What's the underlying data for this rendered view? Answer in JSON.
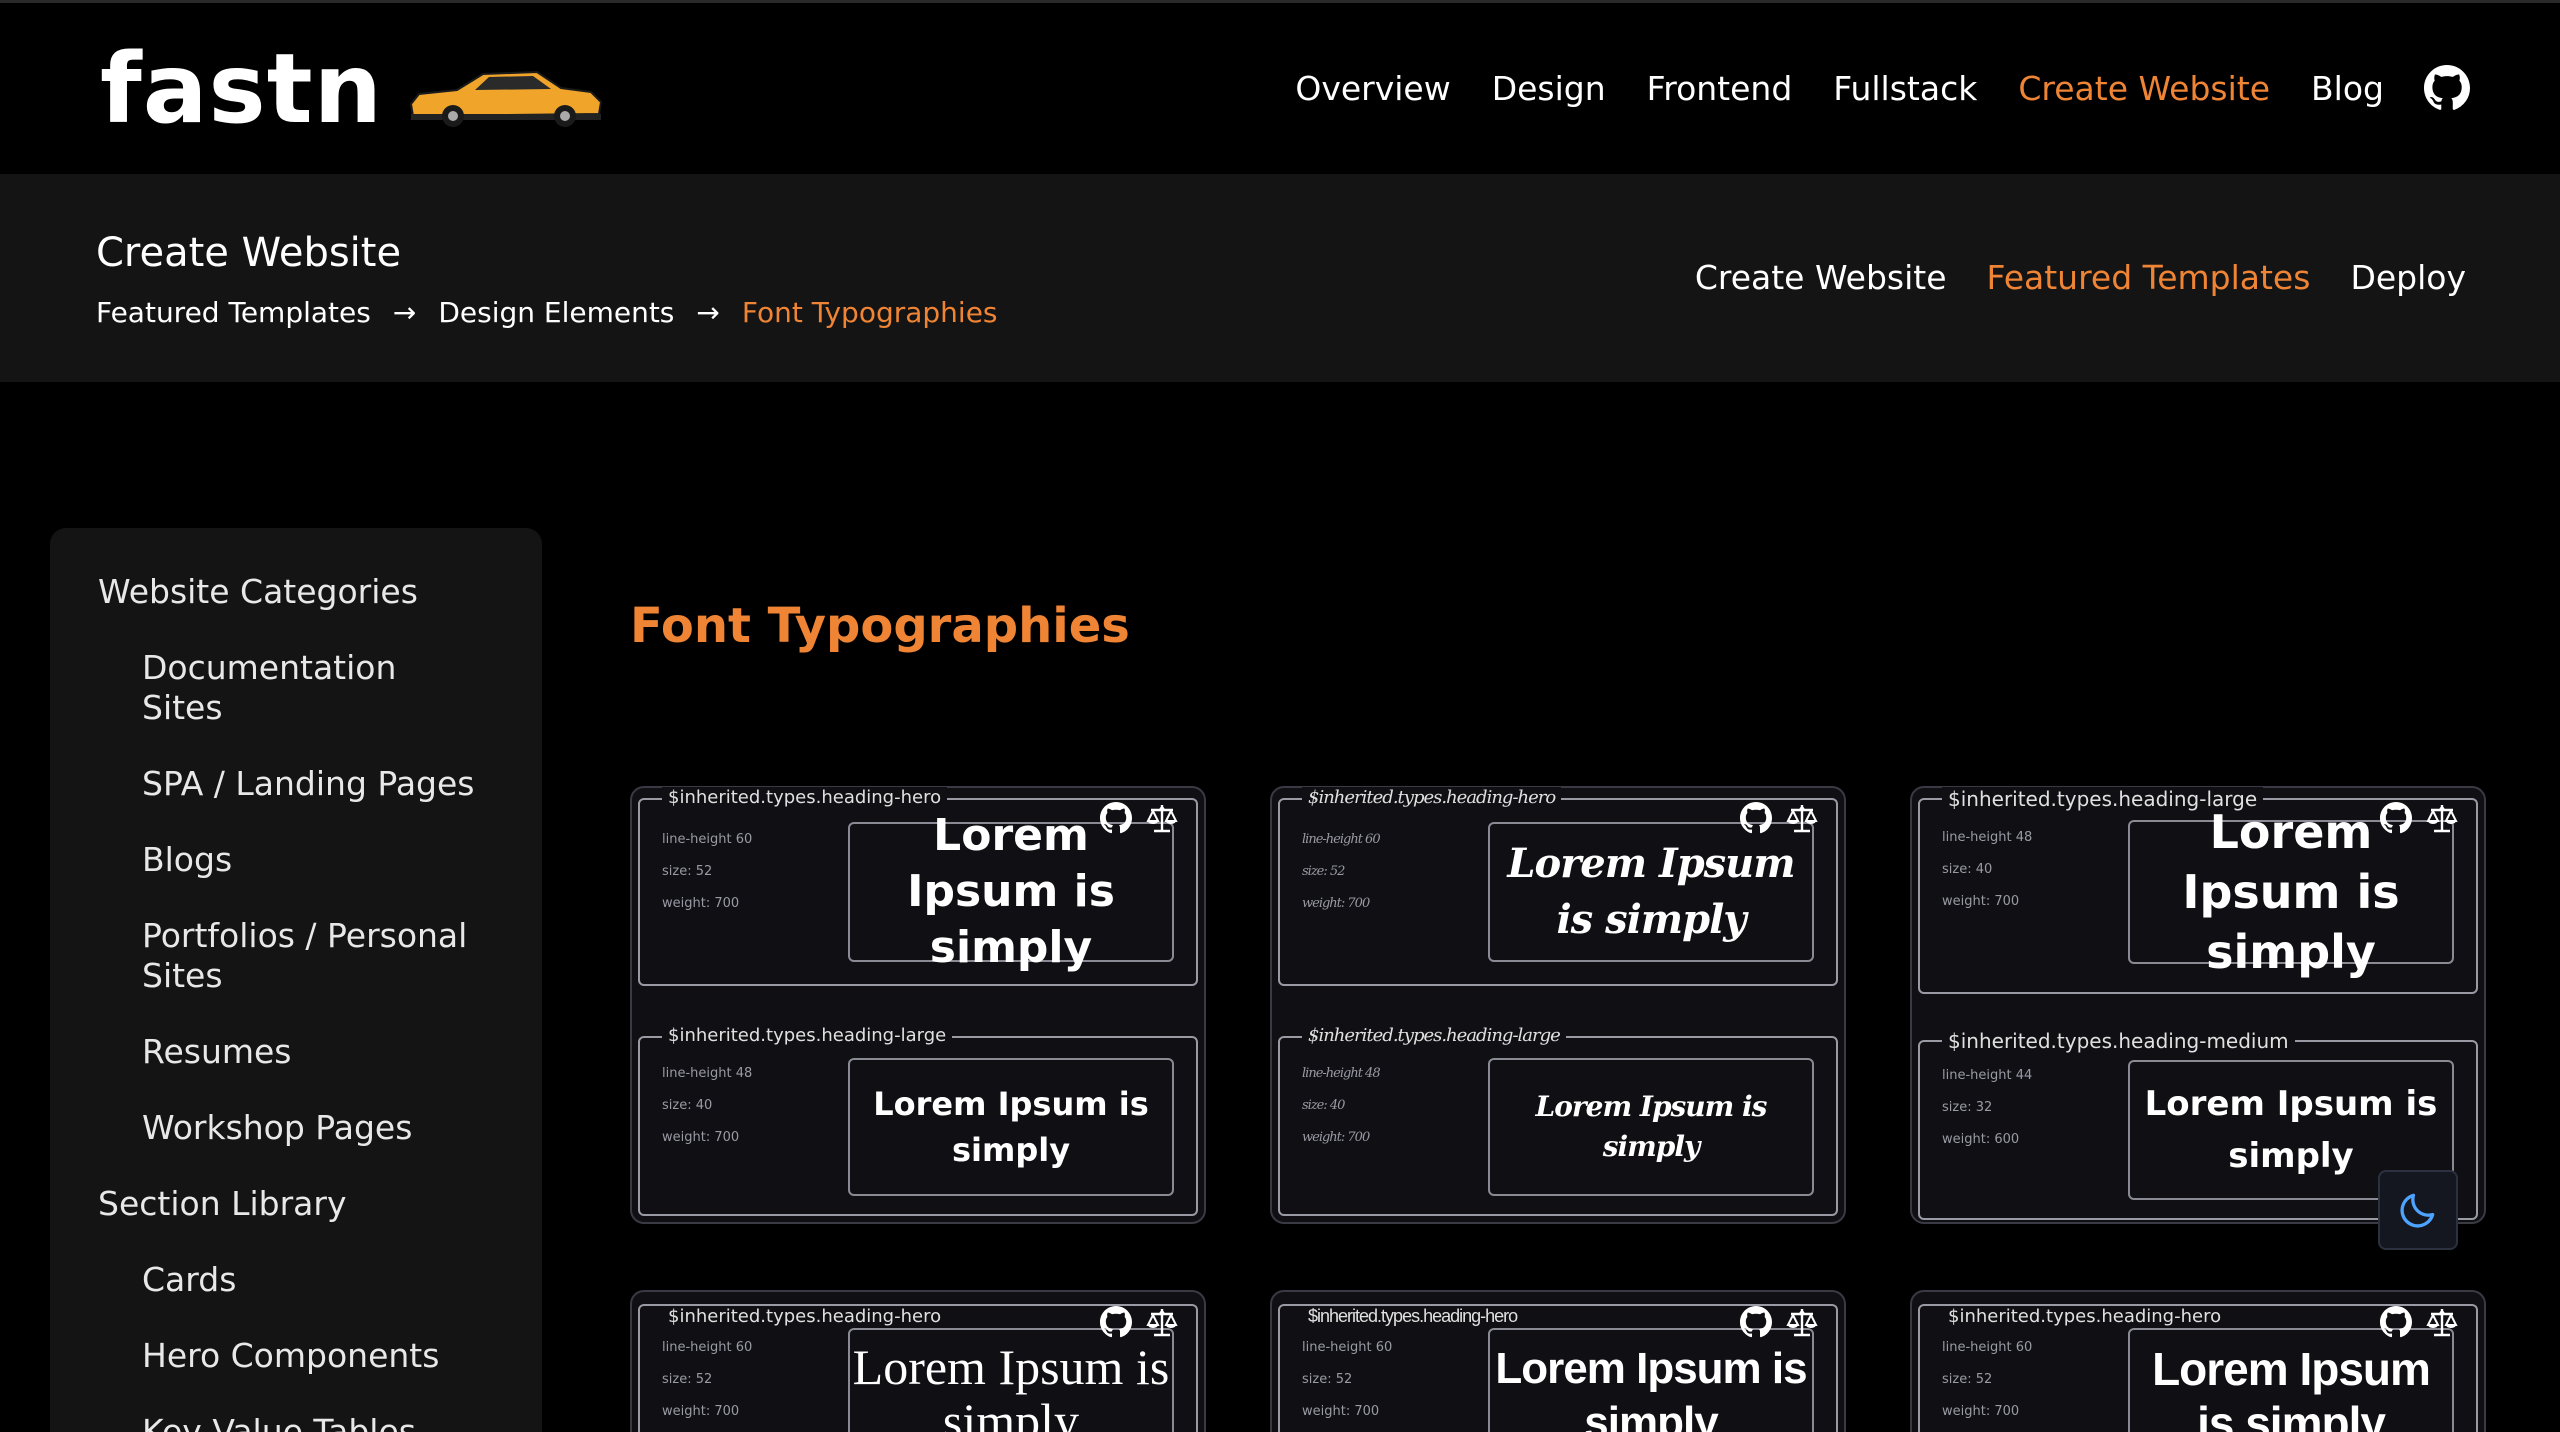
{
  "header": {
    "logo_text": "fastn",
    "nav": [
      {
        "label": "Overview",
        "active": false
      },
      {
        "label": "Design",
        "active": false
      },
      {
        "label": "Frontend",
        "active": false
      },
      {
        "label": "Fullstack",
        "active": false
      },
      {
        "label": "Create Website",
        "active": true
      },
      {
        "label": "Blog",
        "active": false
      }
    ],
    "github_icon": "github-icon"
  },
  "subheader": {
    "title": "Create Website",
    "breadcrumb": [
      "Featured Templates",
      "Design Elements",
      "Font Typographies"
    ],
    "arrow": "→",
    "nav": [
      {
        "label": "Create Website",
        "active": false
      },
      {
        "label": "Featured Templates",
        "active": true
      },
      {
        "label": "Deploy",
        "active": false
      }
    ]
  },
  "sidebar": {
    "items": [
      {
        "label": "Website Categories",
        "level": 0
      },
      {
        "label": "Documentation Sites",
        "level": 1
      },
      {
        "label": "SPA / Landing Pages",
        "level": 1
      },
      {
        "label": "Blogs",
        "level": 1
      },
      {
        "label": "Portfolios / Personal Sites",
        "level": 1
      },
      {
        "label": "Resumes",
        "level": 1
      },
      {
        "label": "Workshop Pages",
        "level": 1
      },
      {
        "label": "Section Library",
        "level": 0
      },
      {
        "label": "Cards",
        "level": 1
      },
      {
        "label": "Hero Components",
        "level": 1
      },
      {
        "label": "Key Value Tables",
        "level": 1
      }
    ]
  },
  "main": {
    "heading": "Font Typographies",
    "cards": [
      {
        "panels": [
          {
            "label": "$inherited.types.heading-hero",
            "line_height": "line-height  60",
            "size": "size:  52",
            "weight": "weight:  700",
            "sample": "Lorem Ipsum is simply"
          },
          {
            "label": "$inherited.types.heading-large",
            "line_height": "line-height  48",
            "size": "size:  40",
            "weight": "weight:  700",
            "sample": "Lorem Ipsum is simply"
          }
        ]
      },
      {
        "panels": [
          {
            "label": "$inherited.types.heading-hero",
            "line_height": "line-height  60",
            "size": "size:  52",
            "weight": "weight:  700",
            "sample": "Lorem Ipsum is simply"
          },
          {
            "label": "$inherited.types.heading-large",
            "line_height": "line-height  48",
            "size": "size:  40",
            "weight": "weight:  700",
            "sample": "Lorem Ipsum is simply"
          }
        ]
      },
      {
        "panels": [
          {
            "label": "$inherited.types.heading-large",
            "line_height": "line-height  48",
            "size": "size:  40",
            "weight": "weight:  700",
            "sample": "Lorem Ipsum is simply"
          },
          {
            "label": "$inherited.types.heading-medium",
            "line_height": "line-height  44",
            "size": "size:  32",
            "weight": "weight:  600",
            "sample": "Lorem Ipsum is simply"
          }
        ]
      },
      {
        "panels": [
          {
            "label": "$inherited.types.heading-hero",
            "line_height": "line-height  60",
            "size": "size:  52",
            "weight": "weight:  700",
            "sample": "Lorem Ipsum is simply"
          }
        ]
      },
      {
        "panels": [
          {
            "label": "$inherited.types.heading-hero",
            "line_height": "line-height  60",
            "size": "size:  52",
            "weight": "weight:  700",
            "sample": "Lorem Ipsum is simply"
          }
        ]
      },
      {
        "panels": [
          {
            "label": "$inherited.types.heading-hero",
            "line_height": "line-height  60",
            "size": "size:  52",
            "weight": "weight:  700",
            "sample": "Lorem Ipsum is simply"
          }
        ]
      }
    ]
  },
  "theme_toggle_icon": "moon-icon",
  "colors": {
    "accent": "#ef8435",
    "background": "#000000",
    "panel": "#141414",
    "toggle_icon": "#4da3ff"
  }
}
